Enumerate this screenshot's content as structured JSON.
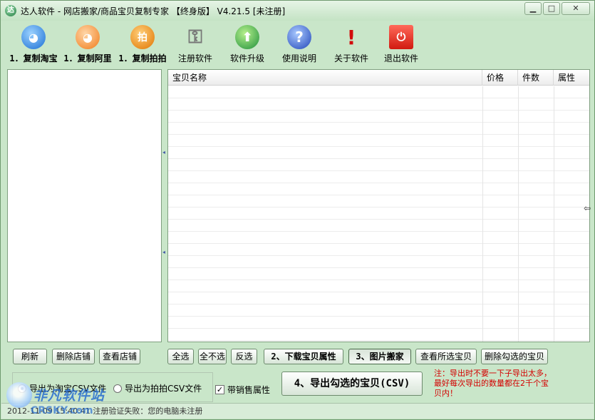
{
  "window": {
    "title": "达人软件 - 网店搬家/商品宝贝复制专家 【终身版】 V4.21.5 [未注册]",
    "app_icon_letter": "达",
    "minimize": "▁",
    "maximize": "□",
    "close": "✕"
  },
  "toolbar": {
    "items": [
      {
        "label": "1．复制淘宝",
        "icon": "taobao-icon",
        "glyph": "◕"
      },
      {
        "label": "1．复制阿里",
        "icon": "alibaba-icon",
        "glyph": "◕"
      },
      {
        "label": "1．复制拍拍",
        "icon": "paipai-icon",
        "glyph": "拍"
      },
      {
        "label": "注册软件",
        "icon": "keys-icon",
        "glyph": "⚿"
      },
      {
        "label": "软件升级",
        "icon": "upgrade-icon",
        "glyph": "⬆"
      },
      {
        "label": "使用说明",
        "icon": "help-icon",
        "glyph": "?"
      },
      {
        "label": "关于软件",
        "icon": "about-icon",
        "glyph": "!"
      },
      {
        "label": "退出软件",
        "icon": "exit-icon",
        "glyph": "⏻"
      }
    ]
  },
  "grid": {
    "columns": [
      "宝贝名称",
      "价格",
      "件数",
      "属性"
    ]
  },
  "left_buttons": {
    "refresh": "刷新",
    "delete_store": "删除店铺",
    "view_store": "查看店铺"
  },
  "grid_buttons": {
    "select_all": "全选",
    "select_none": "全不选",
    "invert": "反选",
    "download_attrs": "2、下载宝贝属性",
    "move_images": "3、图片搬家",
    "view_selected": "查看所选宝贝",
    "delete_checked": "删除勾选的宝贝"
  },
  "export": {
    "taobao_csv": "导出为淘宝CSV文件",
    "paipai_csv": "导出为拍拍CSV文件",
    "with_sales_attr": "带销售属性",
    "with_sales_checked": "✓",
    "export_button": "4、导出勾选的宝贝(CSV)"
  },
  "note": "注：导出时不要一下子导出太多，最好每次导出的数量都在2千个宝贝内！",
  "status": "2012-11-09 15:40:41  注册验证失败：您的电脑未注册",
  "watermark": {
    "text": "非凡软件站",
    "sub": "CRSKY.com"
  }
}
